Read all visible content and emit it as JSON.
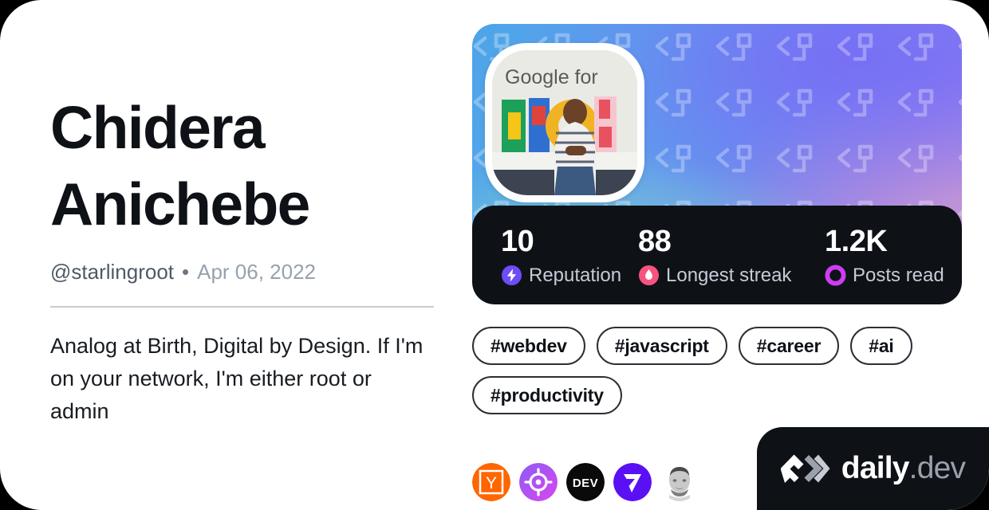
{
  "profile": {
    "display_name": "Chidera Anichebe",
    "handle": "@starlingroot",
    "separator": "•",
    "joined_date": "Apr 06, 2022",
    "bio": "Analog at Birth, Digital by Design. If I'm on your network, I'm either root or admin",
    "avatar_alt": "Google for Nigeria photo"
  },
  "stats": [
    {
      "value": "10",
      "label": "Reputation",
      "icon": "bolt-icon",
      "color": "#6C4DF6"
    },
    {
      "value": "88",
      "label": "Longest streak",
      "icon": "flame-icon",
      "color": "#F8537F"
    },
    {
      "value": "1.2K",
      "label": "Posts read",
      "icon": "ring-icon",
      "color": "#CE3DF3"
    }
  ],
  "tags": [
    {
      "label": "#webdev"
    },
    {
      "label": "#javascript"
    },
    {
      "label": "#career"
    },
    {
      "label": "#ai"
    },
    {
      "label": "#productivity"
    }
  ],
  "sources": [
    {
      "name": "hacker-news-icon",
      "color": "#FF6600"
    },
    {
      "name": "target-icon",
      "color": "#A33EEA"
    },
    {
      "name": "dev-to-icon",
      "color": "#0A0A0A"
    },
    {
      "name": "seven-logo-icon",
      "color": "#5A10F5"
    },
    {
      "name": "portrait-icon",
      "color": "#8C8C8C"
    }
  ],
  "brand": {
    "name": "daily",
    "suffix": ".dev",
    "mark": "chevron-slash-mark"
  },
  "theme": {
    "card_background": "#ffffff",
    "page_background": "#000000",
    "dark_panel": "#0e1217",
    "text_primary": "#0e1217",
    "text_muted": "#98a1ad"
  }
}
